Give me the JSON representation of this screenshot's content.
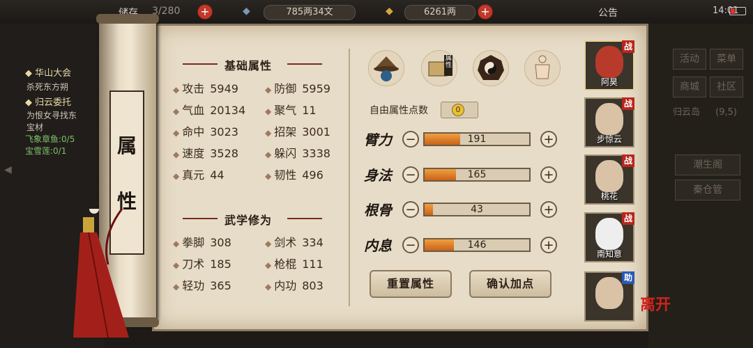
{
  "topbar": {
    "inventory_label": "储存",
    "inventory_count": "3/280",
    "silver": "785两34文",
    "gold": "6261两",
    "announce": "公告",
    "time": "14:01"
  },
  "quests": [
    {
      "title": "华山大会",
      "desc": "杀死东方朔"
    },
    {
      "title": "归云委托",
      "desc": "为恨女寻找东",
      "desc2": "宝材",
      "prog1": "飞象章鱼:0/5",
      "prog2": "宝雪莲:0/1"
    }
  ],
  "scroll": {
    "title1": "属",
    "title2": "性"
  },
  "sections": {
    "basic": "基础属性",
    "martial": "武学修为"
  },
  "basic_stats": [
    {
      "name": "攻击",
      "value": "5949"
    },
    {
      "name": "防御",
      "value": "5959"
    },
    {
      "name": "气血",
      "value": "20134"
    },
    {
      "name": "聚气",
      "value": "11"
    },
    {
      "name": "命中",
      "value": "3023"
    },
    {
      "name": "招架",
      "value": "3001"
    },
    {
      "name": "速度",
      "value": "3528"
    },
    {
      "name": "躲闪",
      "value": "3338"
    },
    {
      "name": "真元",
      "value": "44"
    },
    {
      "name": "韧性",
      "value": "496"
    }
  ],
  "martial_stats": [
    {
      "name": "拳脚",
      "value": "308"
    },
    {
      "name": "剑术",
      "value": "334"
    },
    {
      "name": "刀术",
      "value": "185"
    },
    {
      "name": "枪棍",
      "value": "111"
    },
    {
      "name": "轻功",
      "value": "365"
    },
    {
      "name": "内功",
      "value": "803"
    }
  ],
  "tool_icons": [
    "hat-icon",
    "attribute-book-icon",
    "taiji-icon",
    "meridian-icon"
  ],
  "tool_badge": "属性",
  "free_points_label": "自由属性点数",
  "free_points": "0",
  "attributes": [
    {
      "name": "臂力",
      "value": "191",
      "fill": 0.34
    },
    {
      "name": "身法",
      "value": "165",
      "fill": 0.3
    },
    {
      "name": "根骨",
      "value": "43",
      "fill": 0.08
    },
    {
      "name": "内息",
      "value": "146",
      "fill": 0.28
    }
  ],
  "buttons": {
    "reset": "重置属性",
    "confirm": "确认加点"
  },
  "party": [
    {
      "name": "阿昊",
      "badge": "战"
    },
    {
      "name": "步惊云",
      "badge": "战"
    },
    {
      "name": "桃花",
      "badge": "战"
    },
    {
      "name": "南知意",
      "badge": "战"
    },
    {
      "name": "",
      "badge": "助"
    }
  ],
  "leave_label": "离开",
  "side_menu": [
    "活动",
    "菜单",
    "商城",
    "社区",
    "归云岛",
    "潮生阁",
    "秦仓管"
  ],
  "location_coords": "(9,5)"
}
